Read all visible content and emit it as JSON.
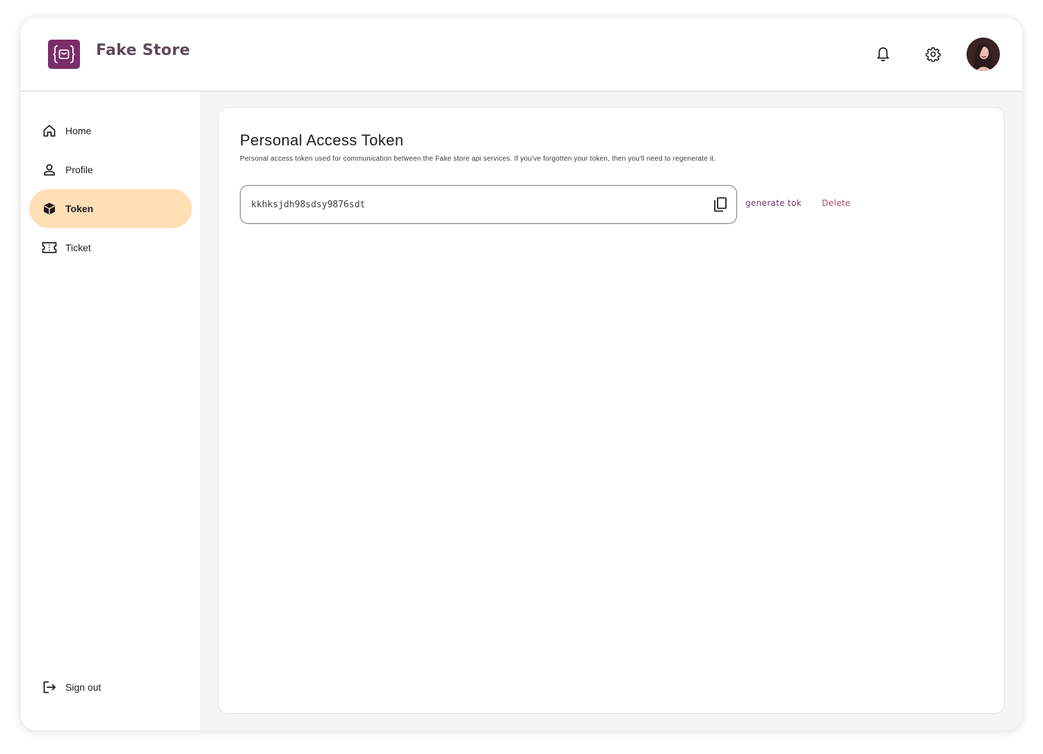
{
  "app": {
    "brand": "Fake Store",
    "accent_color": "#7b2d6a",
    "active_nav_color": "#ffdfb5"
  },
  "header": {
    "icons": [
      "bell-icon",
      "gear-icon"
    ],
    "avatar": "user-avatar"
  },
  "sidebar": {
    "items": [
      {
        "label": "Home",
        "icon": "home-icon",
        "active": false
      },
      {
        "label": "Profile",
        "icon": "person-icon",
        "active": false
      },
      {
        "label": "Token",
        "icon": "cube-icon",
        "active": true
      },
      {
        "label": "Ticket",
        "icon": "ticket-icon",
        "active": false
      }
    ],
    "signout": {
      "label": "Sign out",
      "icon": "logout-icon"
    }
  },
  "main": {
    "title": "Personal Access Token",
    "description": "Personal access token used for communication between the Fake store api services. If you've forgotten your token, then you'll need to regenerate it.",
    "token_value": "kkhksjdh98sdsy9876sdt",
    "generate_label": "generate tok",
    "delete_label": "Delete"
  }
}
